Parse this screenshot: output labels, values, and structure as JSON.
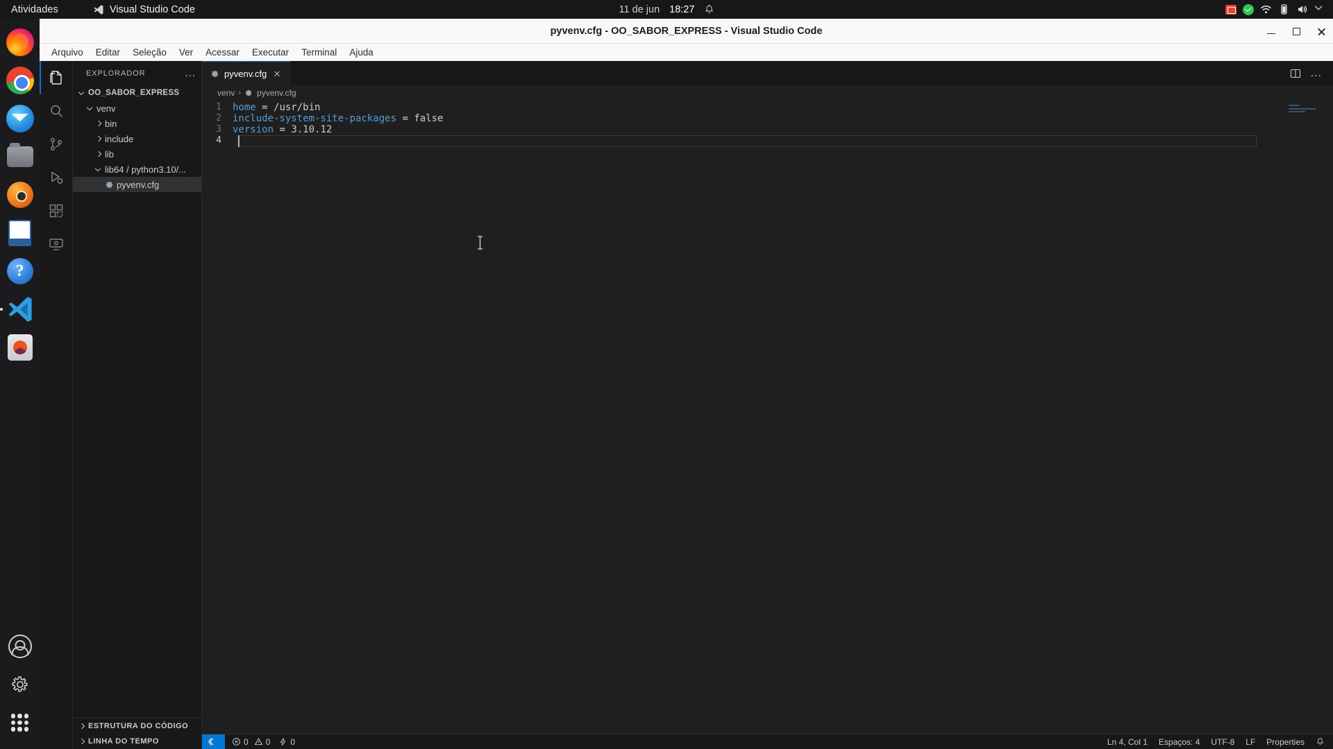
{
  "desktop": {
    "activities_label": "Atividades",
    "app_name": "Visual Studio Code",
    "clock_date": "11 de jun",
    "clock_time": "18:27",
    "tray": [
      "screen-record-icon",
      "shield-check-icon",
      "wifi-icon",
      "battery-icon",
      "volume-icon",
      "power-menu-icon"
    ],
    "dock_items": [
      {
        "name": "firefox",
        "label": "Firefox"
      },
      {
        "name": "chrome",
        "label": "Google Chrome"
      },
      {
        "name": "thunderbird",
        "label": "Thunderbird Mail"
      },
      {
        "name": "files",
        "label": "Arquivos"
      },
      {
        "name": "rhythmbox",
        "label": "Rhythmbox"
      },
      {
        "name": "libreoffice-writer",
        "label": "LibreOffice Writer"
      },
      {
        "name": "help",
        "label": "Ajuda"
      },
      {
        "name": "vscode",
        "label": "Visual Studio Code"
      },
      {
        "name": "software",
        "label": "Central de Programas"
      }
    ],
    "dock_bottom": [
      {
        "name": "user-account",
        "label": "Conta do usuário"
      },
      {
        "name": "settings",
        "label": "Configurações"
      },
      {
        "name": "show-apps",
        "label": "Mostrar aplicativos"
      }
    ]
  },
  "window": {
    "title": "pyvenv.cfg - OO_SABOR_EXPRESS - Visual Studio Code",
    "controls": {
      "minimize": "Minimizar",
      "maximize": "Maximizar",
      "close": "Fechar"
    }
  },
  "menubar": {
    "items": [
      "Arquivo",
      "Editar",
      "Seleção",
      "Ver",
      "Acessar",
      "Executar",
      "Terminal",
      "Ajuda"
    ]
  },
  "activitybar": {
    "items": [
      {
        "name": "explorer",
        "label": "Explorador",
        "icon": "files-icon",
        "active": true
      },
      {
        "name": "search",
        "label": "Pesquisar",
        "icon": "search-icon",
        "active": false
      },
      {
        "name": "source-control",
        "label": "Controle do Código-Fonte",
        "icon": "source-control-icon",
        "active": false
      },
      {
        "name": "run-debug",
        "label": "Executar e Depurar",
        "icon": "run-debug-icon",
        "active": false
      },
      {
        "name": "extensions",
        "label": "Extensões",
        "icon": "extensions-icon",
        "active": false
      },
      {
        "name": "remote-explorer",
        "label": "Explorador Remoto",
        "icon": "remote-explorer-icon",
        "active": false
      }
    ]
  },
  "sidebar": {
    "header_title": "EXPLORADOR",
    "header_actions": "...",
    "tree": [
      {
        "label": "OO_SABOR_EXPRESS",
        "level": 0,
        "twisty": "down",
        "type": "root",
        "selected": false
      },
      {
        "label": "venv",
        "level": 1,
        "twisty": "down",
        "type": "folder",
        "selected": false
      },
      {
        "label": "bin",
        "level": 2,
        "twisty": "right",
        "type": "folder",
        "selected": false
      },
      {
        "label": "include",
        "level": 2,
        "twisty": "right",
        "type": "folder",
        "selected": false
      },
      {
        "label": "lib",
        "level": 2,
        "twisty": "right",
        "type": "folder",
        "selected": false
      },
      {
        "label": "lib64 / python3.10/...",
        "level": 2,
        "twisty": "down",
        "type": "folder",
        "selected": false
      },
      {
        "label": "pyvenv.cfg",
        "level": 2,
        "twisty": "none",
        "type": "config-file",
        "selected": true
      }
    ],
    "bottom_sections": [
      {
        "label": "ESTRUTURA DO CÓDIGO",
        "twisty": "right"
      },
      {
        "label": "LINHA DO TEMPO",
        "twisty": "right"
      }
    ]
  },
  "editor": {
    "tabs": [
      {
        "label": "pyvenv.cfg",
        "icon": "gear-icon",
        "active": true,
        "close": "×"
      }
    ],
    "tab_actions": {
      "split": "Dividir Editor",
      "more": "..."
    },
    "breadcrumbs": [
      "venv",
      "pyvenv.cfg"
    ],
    "lines": [
      {
        "number": "1",
        "tokens": [
          {
            "t": "home",
            "c": "key"
          },
          {
            "t": " = ",
            "c": "op"
          },
          {
            "t": "/usr/bin",
            "c": "val"
          }
        ]
      },
      {
        "number": "2",
        "tokens": [
          {
            "t": "include-system-site-packages",
            "c": "key"
          },
          {
            "t": " = ",
            "c": "op"
          },
          {
            "t": "false",
            "c": "val"
          }
        ]
      },
      {
        "number": "3",
        "tokens": [
          {
            "t": "version",
            "c": "key"
          },
          {
            "t": " = ",
            "c": "op"
          },
          {
            "t": "3.10.12",
            "c": "num"
          }
        ]
      },
      {
        "number": "4",
        "tokens": [
          {
            "t": "",
            "c": "val"
          }
        ]
      }
    ]
  },
  "statusbar": {
    "remote_label": "",
    "errors": "0",
    "warnings": "0",
    "ports": "0",
    "cursor_position": "Ln 4, Col 1",
    "indentation": "Espaços: 4",
    "encoding": "UTF-8",
    "eol": "LF",
    "language": "Properties",
    "bell": "notifications-icon"
  },
  "colors": {
    "accent": "#0078d4",
    "editor_bg": "#1f1f1f",
    "sidebar_bg": "#181818",
    "titlebar_bg": "#f8f8f8",
    "keyword": "#569cd6",
    "text": "#cccccc"
  }
}
